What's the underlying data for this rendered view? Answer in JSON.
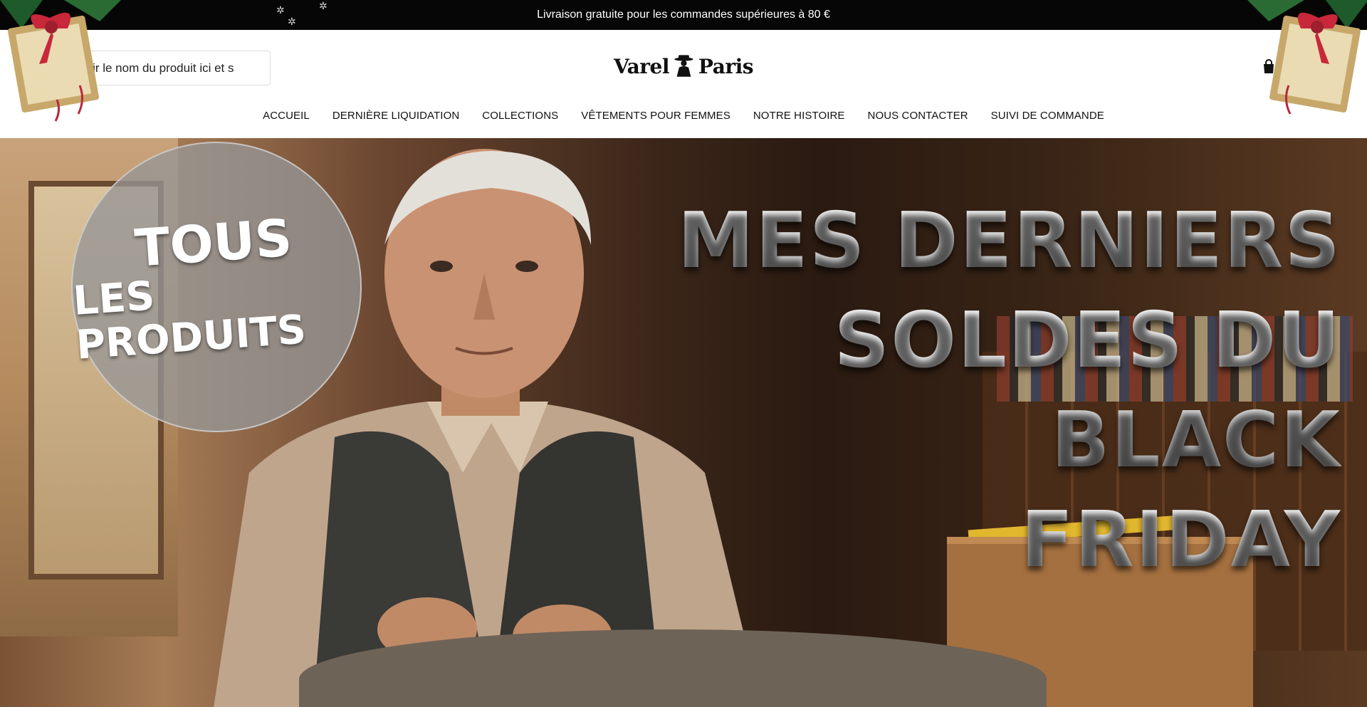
{
  "announcement": {
    "text": "Livraison gratuite pour les commandes supérieures à 80 €"
  },
  "search": {
    "value": "Saisir le nom du produit ici et s",
    "icon": "search-icon"
  },
  "brand": {
    "left": "Varel",
    "right": "Paris",
    "logo_icon": "hat-man-icon"
  },
  "cart": {
    "icon": "cart-icon"
  },
  "nav": {
    "items": [
      {
        "label": "ACCUEIL"
      },
      {
        "label": "DERNIÈRE LIQUIDATION"
      },
      {
        "label": "COLLECTIONS"
      },
      {
        "label": "VÊTEMENTS POUR FEMMES"
      },
      {
        "label": "NOTRE HISTOIRE"
      },
      {
        "label": "NOUS CONTACTER"
      },
      {
        "label": "SUIVI DE COMMANDE"
      }
    ]
  },
  "hero": {
    "badge_line1": "TOUS",
    "badge_line2": "LES PRODUITS",
    "headline": [
      "MES DERNIERS",
      "SOLDES DU BLACK",
      "FRIDAY"
    ]
  },
  "colors": {
    "announcement_bg": "#060606",
    "text": "#111111"
  }
}
